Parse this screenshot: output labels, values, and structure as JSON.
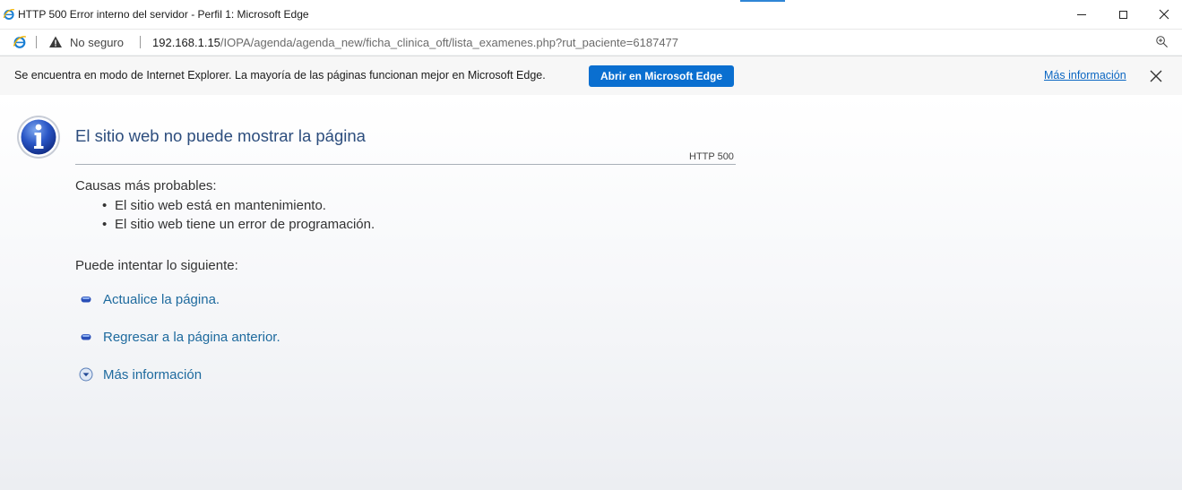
{
  "window": {
    "title": "HTTP 500 Error interno del servidor - Perfil 1: Microsoft Edge",
    "app_icon": "internet-explorer-icon",
    "accent_color": "#2f86d6"
  },
  "address_bar": {
    "security_label": "No seguro",
    "url_host": "192.168.1.15",
    "url_path": "/IOPA/agenda/agenda_new/ficha_clinica_oft/lista_examenes.php?rut_paciente=6187477",
    "zoom_icon": "zoom-icon"
  },
  "infobar": {
    "message": "Se encuentra en modo de Internet Explorer. La mayoría de las páginas funcionan mejor en Microsoft Edge.",
    "open_button": "Abrir en Microsoft Edge",
    "more_info_link": "Más información",
    "button_color": "#0a6fd0"
  },
  "error_page": {
    "title": "El sitio web no puede mostrar la página",
    "code": "HTTP 500",
    "causes_heading": "Causas más probables:",
    "causes": [
      "El sitio web está en mantenimiento.",
      "El sitio web tiene un error de programación."
    ],
    "try_heading": "Puede intentar lo siguiente:",
    "actions": [
      "Actualice la página.",
      "Regresar a la página anterior.",
      "Más información"
    ],
    "title_color": "#2c4d7d",
    "link_color": "#1e6a9e"
  }
}
